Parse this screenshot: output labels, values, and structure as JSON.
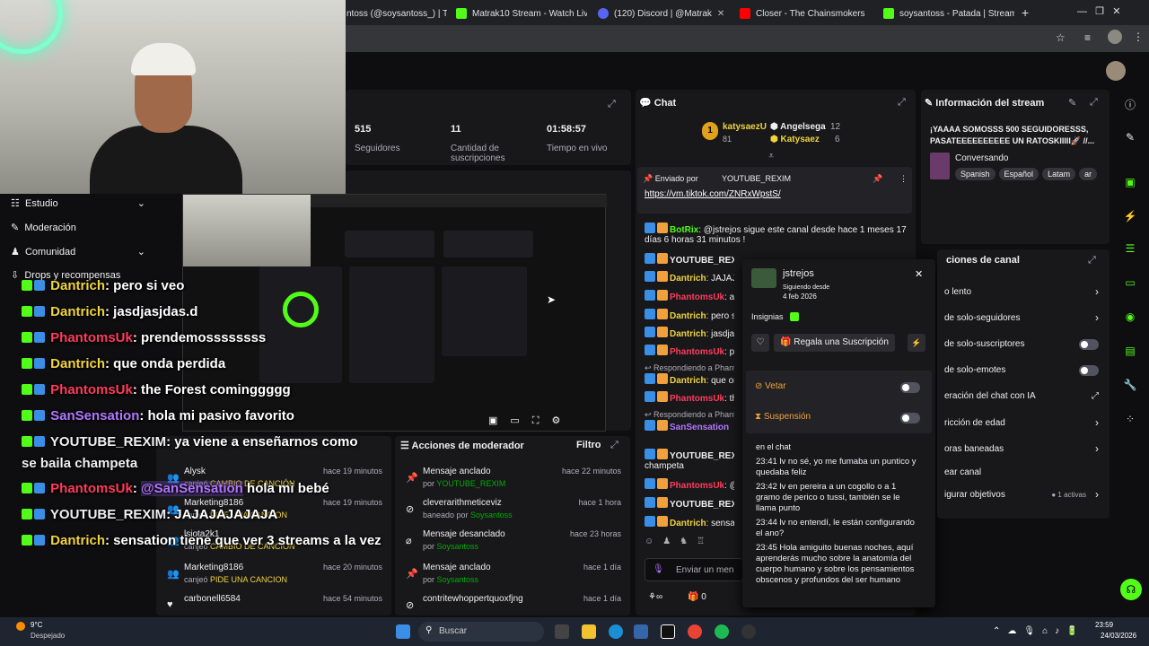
{
  "browser": {
    "tabs": [
      {
        "label": "ntoss (@soysantoss_) | Ti"
      },
      {
        "label": "Matrak10 Stream - Watch Live"
      },
      {
        "label": "(120) Discord | @Matrak"
      },
      {
        "label": "Closer - The Chainsmokers"
      },
      {
        "label": "soysantoss - Patada | Streamer"
      }
    ],
    "new_tab": "+"
  },
  "stats": [
    {
      "value": "515",
      "label": "Seguidores"
    },
    {
      "value": "11",
      "label": "Cantidad de suscripciones"
    },
    {
      "value": "01:58:57",
      "label": "Tiempo en vivo"
    }
  ],
  "left_nav": [
    "Estudio",
    "Moderación",
    "Comunidad",
    "Drops y recompensas"
  ],
  "overlay_chat": [
    {
      "user": "Dantrich",
      "color": "#f0d43c",
      "text": ": pero si veo"
    },
    {
      "user": "Dantrich",
      "color": "#f0d43c",
      "text": ": jasdjasjdas.d"
    },
    {
      "user": "PhantomsUk",
      "color": "#ff3b5c",
      "text": ": prendemossssssss"
    },
    {
      "user": "Dantrich",
      "color": "#f0d43c",
      "text": ": que onda perdida"
    },
    {
      "user": "PhantomsUk",
      "color": "#ff3b5c",
      "text": ": the Forest cominggggg"
    },
    {
      "user": "SanSensation",
      "color": "#b277ff",
      "text": ": hola mi pasivo favorito"
    },
    {
      "user": "YOUTUBE_REXIM",
      "color": "#efeff1",
      "text": ": ya viene a enseñarnos como",
      "text2": "se baila champeta"
    },
    {
      "user": "PhantomsUk",
      "color": "#ff3b5c",
      "text": ": ",
      "mention": "@SanSensation",
      "text_after": " hola mi bebé"
    },
    {
      "user": "YOUTUBE_REXIM",
      "color": "#efeff1",
      "text": ": JAJAJAJAJAJA"
    },
    {
      "user": "Dantrich",
      "color": "#f0d43c",
      "text": ": sensation tiene que ver 3 streams a la vez"
    }
  ],
  "activity": [
    {
      "user": "Alysk",
      "action": "canjeó",
      "reward": "CAMBIO DE CANCIÓN",
      "time": "hace 19 minutos"
    },
    {
      "user": "Marketing8186",
      "action": "canjeó",
      "reward": "PIDE UNA CANCION",
      "time": "hace 19 minutos"
    },
    {
      "user": "lsiota2k1",
      "action": "canjeó",
      "reward": "CAMBIO DE CANCION",
      "time": ""
    },
    {
      "user": "Marketing8186",
      "action": "canjeó",
      "reward": "PIDE UNA CANCION",
      "time": "hace 20 minutos"
    },
    {
      "user": "carbonell6584",
      "action": "",
      "reward": "",
      "time": "hace 54 minutos"
    }
  ],
  "mod_actions": {
    "title": "Acciones de moderador",
    "filter": "Filtro",
    "rows": [
      {
        "title": "Mensaje anclado",
        "by": "por",
        "mod": "YOUTUBE_REXIM",
        "time": "hace 22 minutos",
        "icon": "📌"
      },
      {
        "title": "cleverarithmeticeviz",
        "by": "baneado por",
        "mod": "Soysantoss",
        "time": "hace 1 hora",
        "icon": "⊘"
      },
      {
        "title": "Mensaje desanclado",
        "by": "por",
        "mod": "Soysantoss",
        "time": "hace 23 horas",
        "icon": "⌀"
      },
      {
        "title": "Mensaje anclado",
        "by": "por",
        "mod": "Soysantoss",
        "time": "hace 1 día",
        "icon": "📌"
      },
      {
        "title": "contritewhoppertquoxfjng",
        "by": "",
        "mod": "",
        "time": "hace 1 día",
        "icon": "⊘"
      }
    ]
  },
  "chat": {
    "title": "Chat",
    "leaderboard": [
      {
        "rank": "1",
        "user": "katysaezU",
        "points": "81"
      },
      {
        "user": "Angelsega",
        "points": "12"
      },
      {
        "user": "Katysaez",
        "points": "6"
      }
    ],
    "pinned": {
      "label": "Enviado por",
      "user": "YOUTUBE_REXIM",
      "link": "https://vm.tiktok.com/ZNRxWpstS/"
    },
    "messages": [
      {
        "user": "BotRix",
        "color": "#53fc18",
        "text": ": @jstrejos sigue este canal desde hace 1 meses 17 días 6 horas 31 minutos !"
      },
      {
        "user": "YOUTUBE_REXIM",
        "color": "#efeff1",
        "text": ""
      },
      {
        "user": "Dantrich",
        "color": "#f0d43c",
        "text": ": JAJAJAA"
      },
      {
        "user": "PhantomsUk",
        "color": "#ff3b5c",
        "text": ": ac"
      },
      {
        "user": "Dantrich",
        "color": "#f0d43c",
        "text": ": pero si ve"
      },
      {
        "user": "Dantrich",
        "color": "#f0d43c",
        "text": ": jasdjasjda"
      },
      {
        "user": "PhantomsUk",
        "color": "#ff3b5c",
        "text": ": pr"
      },
      {
        "user": "Dantrich",
        "color": "#f0d43c",
        "text": ": que onda"
      },
      {
        "user": "PhantomsUk",
        "color": "#ff3b5c",
        "text": ": th"
      },
      {
        "user": "SanSensation",
        "color": "#b277ff",
        "text": ""
      },
      {
        "user": "YOUTUBE_REXIM",
        "color": "#efeff1",
        "text": ""
      },
      {
        "user": "PhantomsUk",
        "color": "#ff3b5c",
        "text": ": @"
      },
      {
        "user": "YOUTUBE_REXIM",
        "color": "#efeff1",
        "text": ""
      },
      {
        "user": "Dantrich",
        "color": "#f0d43c",
        "text": ": sensation"
      }
    ],
    "reply_label": "Respondiendo a Phant",
    "champeta": "champeta",
    "input_placeholder": "Enviar un men",
    "footer_count": "0"
  },
  "user_card": {
    "username": "jstrejos",
    "following_label": "Siguiendo desde",
    "following_date": "4 feb 2026",
    "badges_label": "Insignias",
    "gift_button": "Regala una Suscripción",
    "veto": "Vetar",
    "timeout": "Suspensión",
    "history_header": "en el chat",
    "history": [
      {
        "time": "23:41",
        "text": "lv no sé, yo me fumaba un puntico y quedaba feliz"
      },
      {
        "time": "23:42",
        "text": "lv en pereira a un cogollo o a 1 gramo de perico o tussi, también se le llama punto"
      },
      {
        "time": "23:44",
        "text": "lv no entendí, le están configurando el ano?"
      },
      {
        "time": "23:45",
        "text": "Hola amiguito buenas noches, aquí aprenderás mucho sobre la anatomía del cuerpo humano y sobre los pensamientos obscenos y profundos del ser humano"
      }
    ]
  },
  "stream_info": {
    "title": "Información del stream",
    "desc": "¡YAAAA SOMOSSS 500 SEGUIDORESSS, PASATEEEEEEEEEE UN RATOSKIIIII🚀 //...",
    "category": "Conversando",
    "tags": [
      "Spanish",
      "Español",
      "Latam",
      "ar"
    ]
  },
  "channel_settings": {
    "title": "ciones de canal",
    "items": [
      {
        "label": "o lento",
        "kind": "chevron"
      },
      {
        "label": "de solo-seguidores",
        "kind": "chevron"
      },
      {
        "label": "de solo-suscriptores",
        "kind": "toggle"
      },
      {
        "label": "de solo-emotes",
        "kind": "toggle"
      },
      {
        "label": "eración del chat con IA",
        "kind": "link"
      },
      {
        "label": "ricción de edad",
        "kind": "chevron"
      },
      {
        "label": "oras baneadas",
        "kind": "chevron"
      },
      {
        "label": "ear canal",
        "kind": "none"
      },
      {
        "label": "igurar objetivos",
        "kind": "chevron",
        "extra": "1 activas"
      }
    ]
  },
  "taskbar": {
    "weather_temp": "9°C",
    "weather_desc": "Despejado",
    "search": "Buscar",
    "time": "23:59",
    "date": "24/03/2026"
  },
  "colors": {
    "accent": "#53fc18",
    "bg": "#0e0e10",
    "panel": "#18181b"
  }
}
